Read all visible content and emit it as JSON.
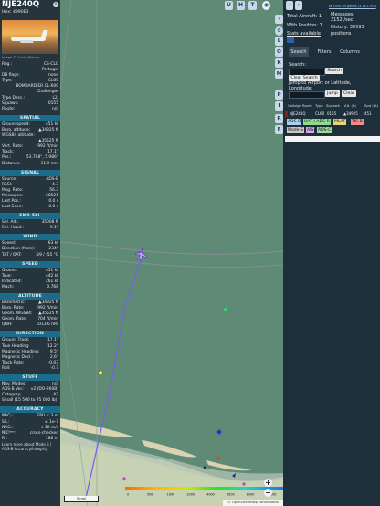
{
  "selected": {
    "callsign": "NJE240Q",
    "hex_label": "Hex:",
    "hex": "4990E3",
    "image_credit": "Image © Guido Pleines",
    "close_icon": "close-icon"
  },
  "info_rows": [
    {
      "label": "Reg.:",
      "value": "CS-CLC"
    },
    {
      "label": "",
      "value": "Portugal"
    },
    {
      "label": "DB flags:",
      "value": "none"
    },
    {
      "label": "Type:",
      "value": "CL60"
    },
    {
      "label": "",
      "value": "BOMBARDIER CL-600"
    },
    {
      "label": "",
      "value": "Challenger"
    },
    {
      "label": "Type Desc.:",
      "value": "L2J"
    },
    {
      "label": "Squawk:",
      "value": "0155"
    },
    {
      "label": "Route:",
      "value": "n/a"
    }
  ],
  "spatial": {
    "title": "SPATIAL",
    "rows": [
      {
        "label": "Groundspeed:",
        "value": "451 kt"
      },
      {
        "label": "Baro. altitude:",
        "value": "▲34925 ft"
      },
      {
        "label": "WGS84 altitude:",
        "value": ""
      },
      {
        "label": "",
        "value": "▲35525 ft"
      },
      {
        "label": "Vert. Rate:",
        "value": "992 ft/min"
      },
      {
        "label": "Track:",
        "value": "17.1°"
      },
      {
        "label": "Pos.:",
        "value": "53.708°, 5.986°"
      },
      {
        "label": "Distance:",
        "value": "31.9 nmi"
      }
    ]
  },
  "signal": {
    "title": "SIGNAL",
    "rows": [
      {
        "label": "Source:",
        "value": "ADS-B"
      },
      {
        "label": "RSSI:",
        "value": "-4.3"
      },
      {
        "label": "Msg. Rate:",
        "value": "56.3"
      },
      {
        "label": "Messages:",
        "value": "28521"
      },
      {
        "label": "Last Pos.:",
        "value": "0.0 s"
      },
      {
        "label": "Last Seen:",
        "value": "0.0 s"
      }
    ]
  },
  "fms": {
    "title": "FMS SEL",
    "rows": [
      {
        "label": "Sel. Alt.:",
        "value": "35008 ft"
      },
      {
        "label": "Sel. Head.:",
        "value": "9.1°"
      }
    ]
  },
  "wind": {
    "title": "WIND",
    "rows": [
      {
        "label": "Speed:",
        "value": "63 kt"
      },
      {
        "label": "Direction (from):",
        "value": "234°"
      },
      {
        "label": "TAT / OAT:",
        "value": "-29 / -55 °C"
      }
    ]
  },
  "speed": {
    "title": "SPEED",
    "rows": [
      {
        "label": "Ground:",
        "value": "451 kt"
      },
      {
        "label": "True:",
        "value": "442 kt"
      },
      {
        "label": "Indicated:",
        "value": "261 kt"
      },
      {
        "label": "Mach:",
        "value": "0.768"
      }
    ]
  },
  "altitude": {
    "title": "ALTITUDE",
    "rows": [
      {
        "label": "Barometric:",
        "value": "▲34925 ft"
      },
      {
        "label": "Baro. Rate:",
        "value": "992 ft/min"
      },
      {
        "label": "Geom. WGS84:",
        "value": "▲35525 ft"
      },
      {
        "label": "Geom. Rate:",
        "value": "704 ft/min"
      },
      {
        "label": "QNH:",
        "value": "1013.6 hPa"
      }
    ]
  },
  "direction": {
    "title": "DIRECTION",
    "rows": [
      {
        "label": "Ground Track:",
        "value": "17.1°"
      },
      {
        "label": "True Heading:",
        "value": "12.2°"
      },
      {
        "label": "Magnetic Heading:",
        "value": "9.5°"
      },
      {
        "label": "Magnetic Decl.:",
        "value": "2.6°"
      },
      {
        "label": "Track Rate:",
        "value": "-0.03"
      },
      {
        "label": "Roll:",
        "value": "-0.7"
      }
    ]
  },
  "stuff": {
    "title": "STUFF",
    "rows": [
      {
        "label": "Nav. Modes:",
        "value": "n/a"
      },
      {
        "label": "ADS-B Ver.:",
        "value": "v2 (DO-260B)"
      },
      {
        "label": "Category:",
        "value": "A2"
      },
      {
        "label": "Small (15 500 to 75 000 lb)",
        "value": ""
      }
    ]
  },
  "accuracy": {
    "title": "ACCURACY",
    "rows": [
      {
        "label": "NACₚ:",
        "value": "EPU < 3 m"
      },
      {
        "label": "SIL:",
        "value": "≤ 1e-7"
      },
      {
        "label": "NACᵥ:",
        "value": "< 10 m/s"
      },
      {
        "label": "NICᵇᵃʳᵒ:",
        "value": "cross-checked"
      },
      {
        "label": "Rᶜ:",
        "value": "186 m"
      }
    ],
    "note": "Learn more about Mode S / ADS-B Accuracy/Integrity"
  },
  "map": {
    "top_buttons": [
      "U",
      "H",
      "T"
    ],
    "side_buttons": [
      "L",
      "O",
      "K",
      "M",
      "P",
      "I",
      "R",
      "F"
    ],
    "zoom_in": "+",
    "zoom_out": "−",
    "scale_label": "5 nmi",
    "attribution": "© OpenStreetMap contributors",
    "legend_labels": [
      "0",
      "500",
      "1000",
      "2000",
      "4000",
      "6000",
      "8000",
      "10000",
      "20000",
      "30000",
      "40000+"
    ]
  },
  "right": {
    "link": "tar1090 on github (3.14.1791)",
    "total_aircraft_label": "Total Aircraft:",
    "total_aircraft": "1",
    "with_position_label": "With Position:",
    "with_position": "1",
    "stats_available": "Stats available",
    "messages_label": "Messages:",
    "messages": "2152 /sec",
    "history_label": "History:",
    "history": "30593 positions",
    "tabs": [
      "Search",
      "Filters",
      "Columns"
    ],
    "search_label": "Search:",
    "search_button": "Search",
    "clear_search": "Clear Search",
    "jump_label": "Jump to Airport or Latitude, Longitude:",
    "jump_button": "Jump",
    "clear_button": "Clear",
    "table_headers": [
      "Callsign",
      "Route",
      "Type",
      "Squawk",
      "Alt. (ft)",
      "Spd (kt)"
    ],
    "table_row": {
      "callsign": "NJE240Q",
      "type": "CL60",
      "squawk": "0155",
      "alt": "▲34925",
      "spd": "451"
    },
    "source_chips": [
      {
        "label": "ADS-B",
        "color": "#a8d0ec"
      },
      {
        "label": "UAT / ADS-R",
        "color": "#8fdc8f"
      },
      {
        "label": "MLAT",
        "color": "#e8d27a"
      },
      {
        "label": "TIS-B",
        "color": "#f08a8a"
      },
      {
        "label": "Mode-S",
        "color": "#c9c9c9"
      },
      {
        "label": "AIS",
        "color": "#d9a9e6"
      },
      {
        "label": "ADS-C",
        "color": "#9fd89f"
      }
    ]
  },
  "colors": {
    "sea": "#5f8a76",
    "panel": "#26343e",
    "section_header": "#1b6b8a",
    "track": "#7b5cf0"
  }
}
